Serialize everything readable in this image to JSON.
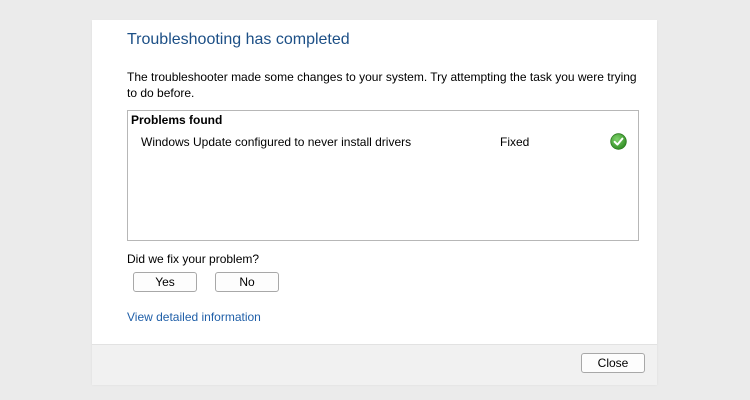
{
  "dialog": {
    "title": "Troubleshooting has completed",
    "description": "The troubleshooter made some changes to your system. Try attempting the task you were trying to do before."
  },
  "problems": {
    "header": "Problems found",
    "items": [
      {
        "name": "Windows Update configured to never install drivers",
        "status": "Fixed",
        "icon": "check-circle-icon",
        "icon_color": "#3a9a2a"
      }
    ]
  },
  "feedback": {
    "question": "Did we fix your problem?",
    "yes_label": "Yes",
    "no_label": "No"
  },
  "details_link": "View detailed information",
  "footer": {
    "close_label": "Close"
  },
  "colors": {
    "title": "#1c4f86",
    "link": "#1f5fa8",
    "background": "#ebebeb",
    "footer": "#f1f1f1"
  }
}
